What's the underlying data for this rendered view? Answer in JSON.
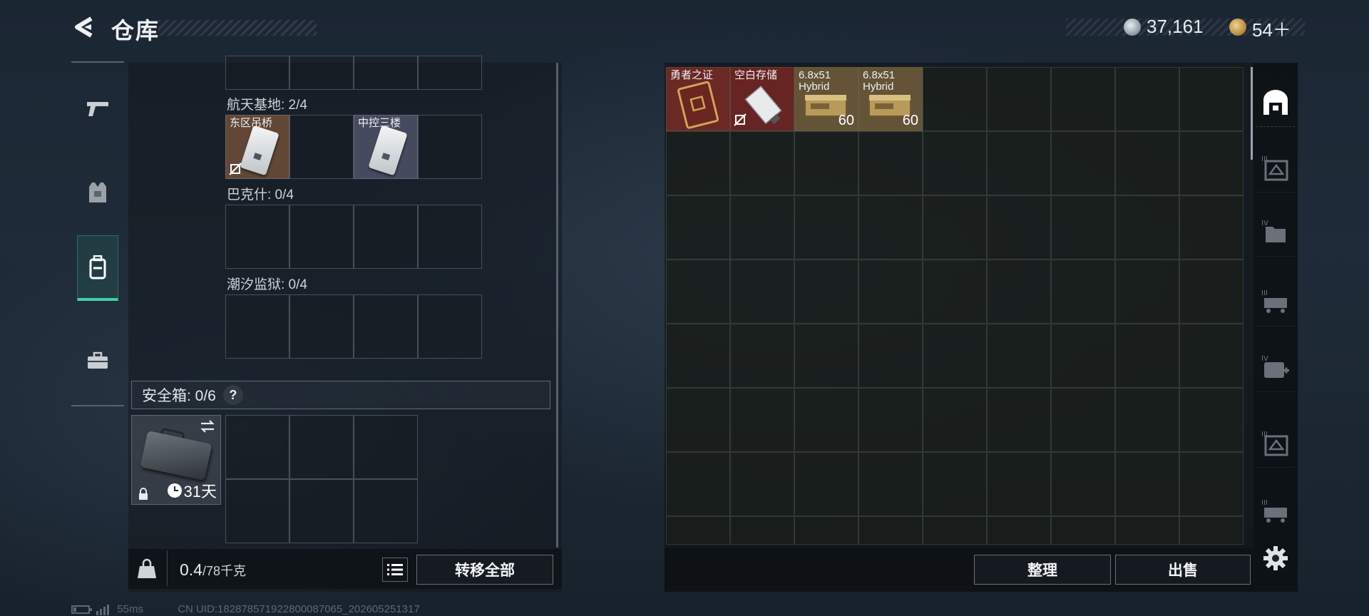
{
  "header": {
    "title": "仓库",
    "back_icon": "back-arrow-icon",
    "currencies": [
      {
        "icon": "silver-coin-icon",
        "value": "37,161"
      },
      {
        "icon": "gold-coin-icon",
        "value": "54＋"
      }
    ]
  },
  "tabs": [
    {
      "name": "weapons",
      "icon": "pistol-icon",
      "active": false
    },
    {
      "name": "armor",
      "icon": "vest-icon",
      "active": false
    },
    {
      "name": "backpack",
      "icon": "backpack-icon",
      "active": true
    },
    {
      "name": "toolbox",
      "icon": "briefcase-icon",
      "active": false
    }
  ],
  "key_sections": [
    {
      "label": "航天基地: 2/4",
      "items": [
        {
          "label": "东区吊桥"
        },
        null,
        {
          "label": "中控三楼"
        },
        null
      ]
    },
    {
      "label": "巴克什: 0/4",
      "items": [
        null,
        null,
        null,
        null
      ]
    },
    {
      "label": "潮汐监狱: 0/4",
      "items": [
        null,
        null,
        null,
        null
      ]
    }
  ],
  "safe_box": {
    "title": "安全箱: 0/6",
    "help": "?",
    "days": "31天"
  },
  "bottom_left": {
    "weight_value": "0.4",
    "weight_unit": "/78千克",
    "transfer_all": "转移全部"
  },
  "stash": {
    "items": [
      {
        "label": "勇者之证",
        "count": ""
      },
      {
        "label": "空白存储",
        "count": ""
      },
      {
        "label": "6.8x51 Hybrid",
        "count": "60"
      },
      {
        "label": "6.8x51 Hybrid",
        "count": "60"
      }
    ],
    "organize": "整理",
    "sell": "出售"
  },
  "side_icons": [
    "safe-house-icon",
    "crate-icon",
    "folder-icon",
    "cart-icon",
    "medkit-icon",
    "crate-icon",
    "cart-icon",
    "settings-icon"
  ],
  "status_bar": {
    "ping": "55ms",
    "uid": "CN UID:1828785719228000870​65_202605251317"
  },
  "colors": {
    "accent": "#3fd0a4",
    "gold": "#d2a455",
    "card_red": "#7a2a26"
  }
}
